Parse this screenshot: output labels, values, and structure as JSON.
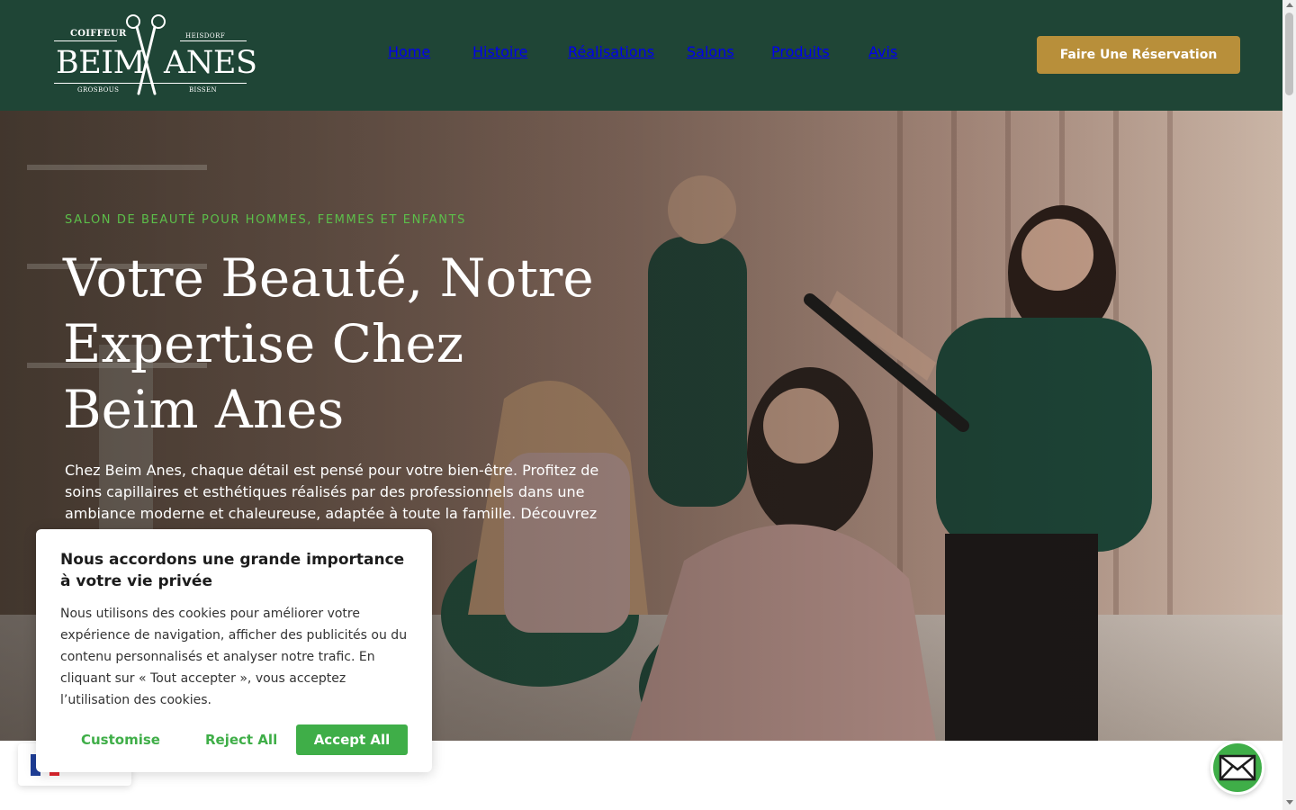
{
  "header": {
    "logo": {
      "top_left": "COIFFEUR",
      "top_right": "HEISDORF",
      "word_left": "BEIM",
      "word_right": "ANES",
      "bottom_left": "GROSBOUS",
      "bottom_right": "BISSEN"
    },
    "nav": [
      "Home",
      "Histoire",
      "Réalisations",
      "Salons",
      "Produits",
      "Avis"
    ],
    "cta_label": "Faire Une Réservation",
    "bg_color": "#1f4536",
    "accent_color": "#c9a24a"
  },
  "hero": {
    "eyebrow": "SALON DE BEAUTÉ POUR HOMMES, FEMMES ET ENFANTS",
    "headline": "Votre Beauté, Notre Expertise Chez Beim Anes",
    "intro": "Chez Beim Anes, chaque détail est pensé pour votre bien-être. Profitez de soins capillaires et esthétiques réalisés par des professionnels dans une ambiance moderne et chaleureuse, adaptée à toute la famille. Découvrez"
  },
  "cookie": {
    "title": "Nous accordons une grande importance à votre vie privée",
    "body": "Nous utilisons des cookies pour améliorer votre expérience de navigation, afficher des publicités ou du contenu personnalisés et analyser notre trafic. En cliquant sur « Tout accepter », vous acceptez l’utilisation des cookies.",
    "customise_label": "Customise",
    "reject_label": "Reject All",
    "accept_label": "Accept All",
    "accent_color": "#3fae48"
  },
  "widgets": {
    "language_flag": "france-flag-icon",
    "mail_icon": "envelope-icon"
  }
}
